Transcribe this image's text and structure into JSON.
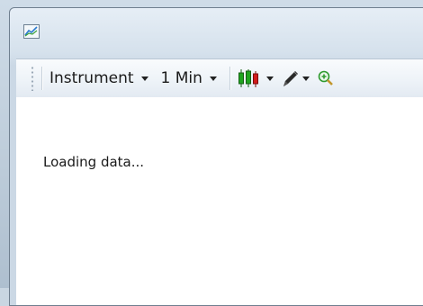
{
  "toolbar": {
    "instrument_label": "Instrument",
    "timeframe_label": "1 Min",
    "chart_style_icon": "candlestick-chart-icon",
    "draw_icon": "pen-drawing-tool-icon",
    "zoom_icon": "zoom-in-icon"
  },
  "titlebar": {
    "app_icon": "chart-app-icon"
  },
  "content": {
    "status": "Loading data..."
  },
  "colors": {
    "candle_up": "#1fa51f",
    "candle_down": "#d21b1b",
    "zoom_accent": "#2f9a2f"
  }
}
